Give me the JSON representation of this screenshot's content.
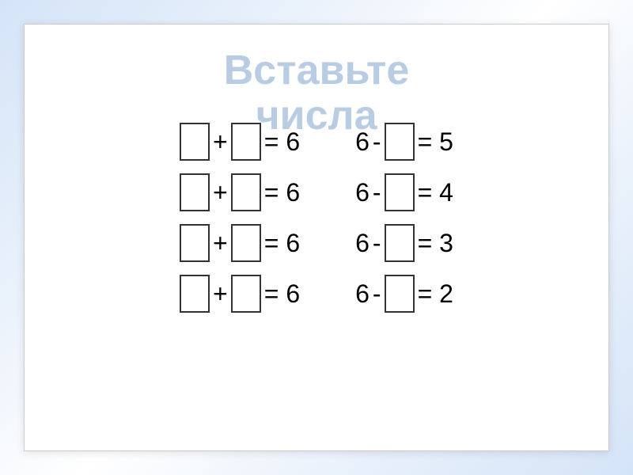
{
  "title": {
    "line1": "Вставьте",
    "line2": "числа"
  },
  "equations": {
    "left": [
      {
        "op": "+",
        "result": "= 6"
      },
      {
        "op": "+",
        "result": "= 6"
      },
      {
        "op": "+",
        "result": "= 6"
      },
      {
        "op": "+",
        "result": "= 6"
      }
    ],
    "right": [
      {
        "num": "6",
        "op": "-",
        "result": "= 5"
      },
      {
        "num": "6",
        "op": "-",
        "result": "= 4"
      },
      {
        "num": "6",
        "op": "-",
        "result": "= 3"
      },
      {
        "num": "6",
        "op": "-",
        "result": "= 2"
      }
    ]
  }
}
